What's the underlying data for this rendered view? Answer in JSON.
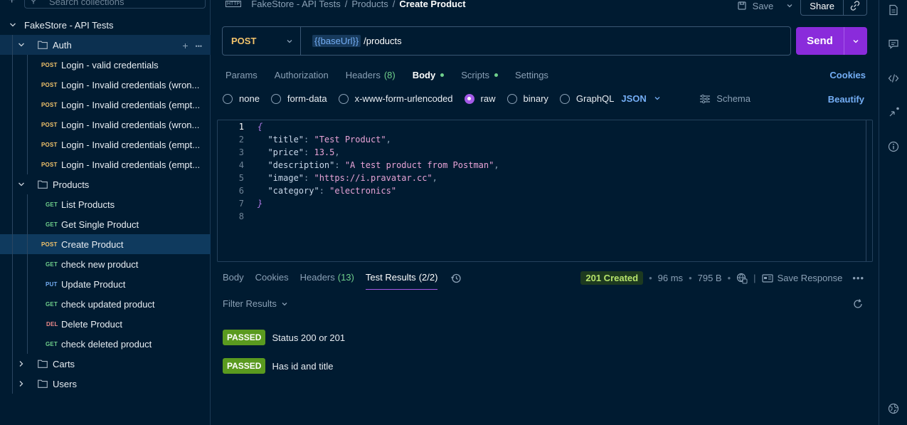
{
  "sidebar": {
    "search_placeholder": "Search collections",
    "collection_name": "FakeStore - API Tests",
    "folders": [
      {
        "name": "Auth",
        "items": [
          {
            "method": "POST",
            "label": "Login - valid credentials"
          },
          {
            "method": "POST",
            "label": "Login - Invalid credentials (wron..."
          },
          {
            "method": "POST",
            "label": "Login - Invalid credentials (empt..."
          },
          {
            "method": "POST",
            "label": "Login - Invalid credentials (wron..."
          },
          {
            "method": "POST",
            "label": "Login - Invalid credentials (empt..."
          },
          {
            "method": "POST",
            "label": "Login - Invalid credentials (empt..."
          }
        ]
      },
      {
        "name": "Products",
        "items": [
          {
            "method": "GET",
            "label": "List Products"
          },
          {
            "method": "GET",
            "label": "Get Single Product"
          },
          {
            "method": "POST",
            "label": "Create Product"
          },
          {
            "method": "GET",
            "label": "check new product"
          },
          {
            "method": "PUT",
            "label": "Update Product"
          },
          {
            "method": "GET",
            "label": "check updated product"
          },
          {
            "method": "DEL",
            "label": "Delete Product"
          },
          {
            "method": "GET",
            "label": "check deleted product"
          }
        ]
      },
      {
        "name": "Carts"
      },
      {
        "name": "Users"
      }
    ]
  },
  "header": {
    "http_icon_text": "HTTP",
    "breadcrumb": [
      "FakeStore - API Tests",
      "Products",
      "Create Product"
    ],
    "separator": "/",
    "save_label": "Save",
    "share_label": "Share"
  },
  "request": {
    "method": "POST",
    "url_var": "{{baseUrl}}",
    "url_path": "/products",
    "send_label": "Send",
    "tabs": [
      {
        "label": "Params"
      },
      {
        "label": "Authorization"
      },
      {
        "label": "Headers",
        "count": "(8)"
      },
      {
        "label": "Body",
        "active": true,
        "dot": true
      },
      {
        "label": "Scripts",
        "dot": true
      },
      {
        "label": "Settings"
      }
    ],
    "cookies_label": "Cookies",
    "body_types": [
      "none",
      "form-data",
      "x-www-form-urlencoded",
      "raw",
      "binary",
      "GraphQL"
    ],
    "selected_body_type": "raw",
    "format": "JSON",
    "schema_label": "Schema",
    "beautify_label": "Beautify",
    "body_lines": [
      {
        "n": "1",
        "parts": [
          [
            "brace",
            "{"
          ]
        ]
      },
      {
        "n": "2",
        "parts": [
          [
            "key",
            "  \"title\""
          ],
          [
            "punct",
            ": "
          ],
          [
            "str",
            "\"Test Product\""
          ],
          [
            "punct",
            ","
          ]
        ]
      },
      {
        "n": "3",
        "parts": [
          [
            "key",
            "  \"price\""
          ],
          [
            "punct",
            ": "
          ],
          [
            "num",
            "13.5"
          ],
          [
            "punct",
            ","
          ]
        ]
      },
      {
        "n": "4",
        "parts": [
          [
            "key",
            "  \"description\""
          ],
          [
            "punct",
            ": "
          ],
          [
            "str",
            "\"A test product from Postman\""
          ],
          [
            "punct",
            ","
          ]
        ]
      },
      {
        "n": "5",
        "parts": [
          [
            "key",
            "  \"image\""
          ],
          [
            "punct",
            ": "
          ],
          [
            "str",
            "\"https://i.pravatar.cc\""
          ],
          [
            "punct",
            ","
          ]
        ]
      },
      {
        "n": "6",
        "parts": [
          [
            "key",
            "  \"category\""
          ],
          [
            "punct",
            ": "
          ],
          [
            "str",
            "\"electronics\""
          ]
        ]
      },
      {
        "n": "7",
        "parts": [
          [
            "brace",
            "}"
          ]
        ]
      },
      {
        "n": "8",
        "parts": []
      }
    ]
  },
  "response": {
    "tabs": [
      {
        "label": "Body"
      },
      {
        "label": "Cookies"
      },
      {
        "label": "Headers",
        "count": "(13)"
      },
      {
        "label": "Test Results",
        "count": "(2/2)",
        "active": true
      }
    ],
    "status": "201 Created",
    "time": "96 ms",
    "size": "795 B",
    "save_response_label": "Save Response",
    "filter_label": "Filter Results",
    "tests": [
      {
        "result": "PASSED",
        "name": "Status 200 or 201"
      },
      {
        "result": "PASSED",
        "name": "Has id and title"
      }
    ]
  },
  "colors": {
    "background": "#001b31",
    "accent": "#8a2bdb",
    "post": "#f2c36b",
    "get": "#6fd08c",
    "put": "#74aef5",
    "del": "#f08b8b",
    "passed": "#5a9a1f"
  }
}
